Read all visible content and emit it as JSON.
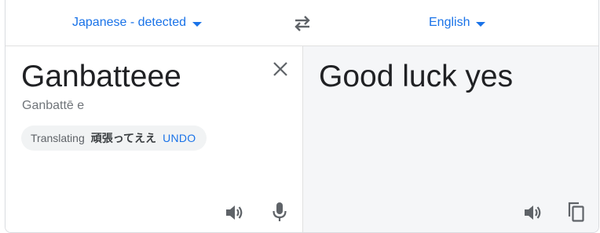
{
  "source_language": {
    "label": "Japanese - detected",
    "icon": "caret-down-icon"
  },
  "target_language": {
    "label": "English",
    "icon": "caret-down-icon"
  },
  "swap": {
    "icon": "swap-languages-icon"
  },
  "source": {
    "text": "Ganbatteee",
    "transliteration": "Ganbattē e",
    "clear_icon": "close-icon",
    "speaker_icon": "speaker-icon",
    "mic_icon": "microphone-icon"
  },
  "suggestion": {
    "label": "Translating",
    "term": "頑張ってええ",
    "undo": "UNDO"
  },
  "target": {
    "text": "Good luck yes",
    "speaker_icon": "speaker-icon",
    "copy_icon": "copy-icon"
  },
  "colors": {
    "accent": "#1a73e8",
    "icon": "#5f6368",
    "text": "#202124",
    "muted": "#70757a",
    "target_bg": "#f5f6f8",
    "chip_bg": "#f1f3f4"
  }
}
